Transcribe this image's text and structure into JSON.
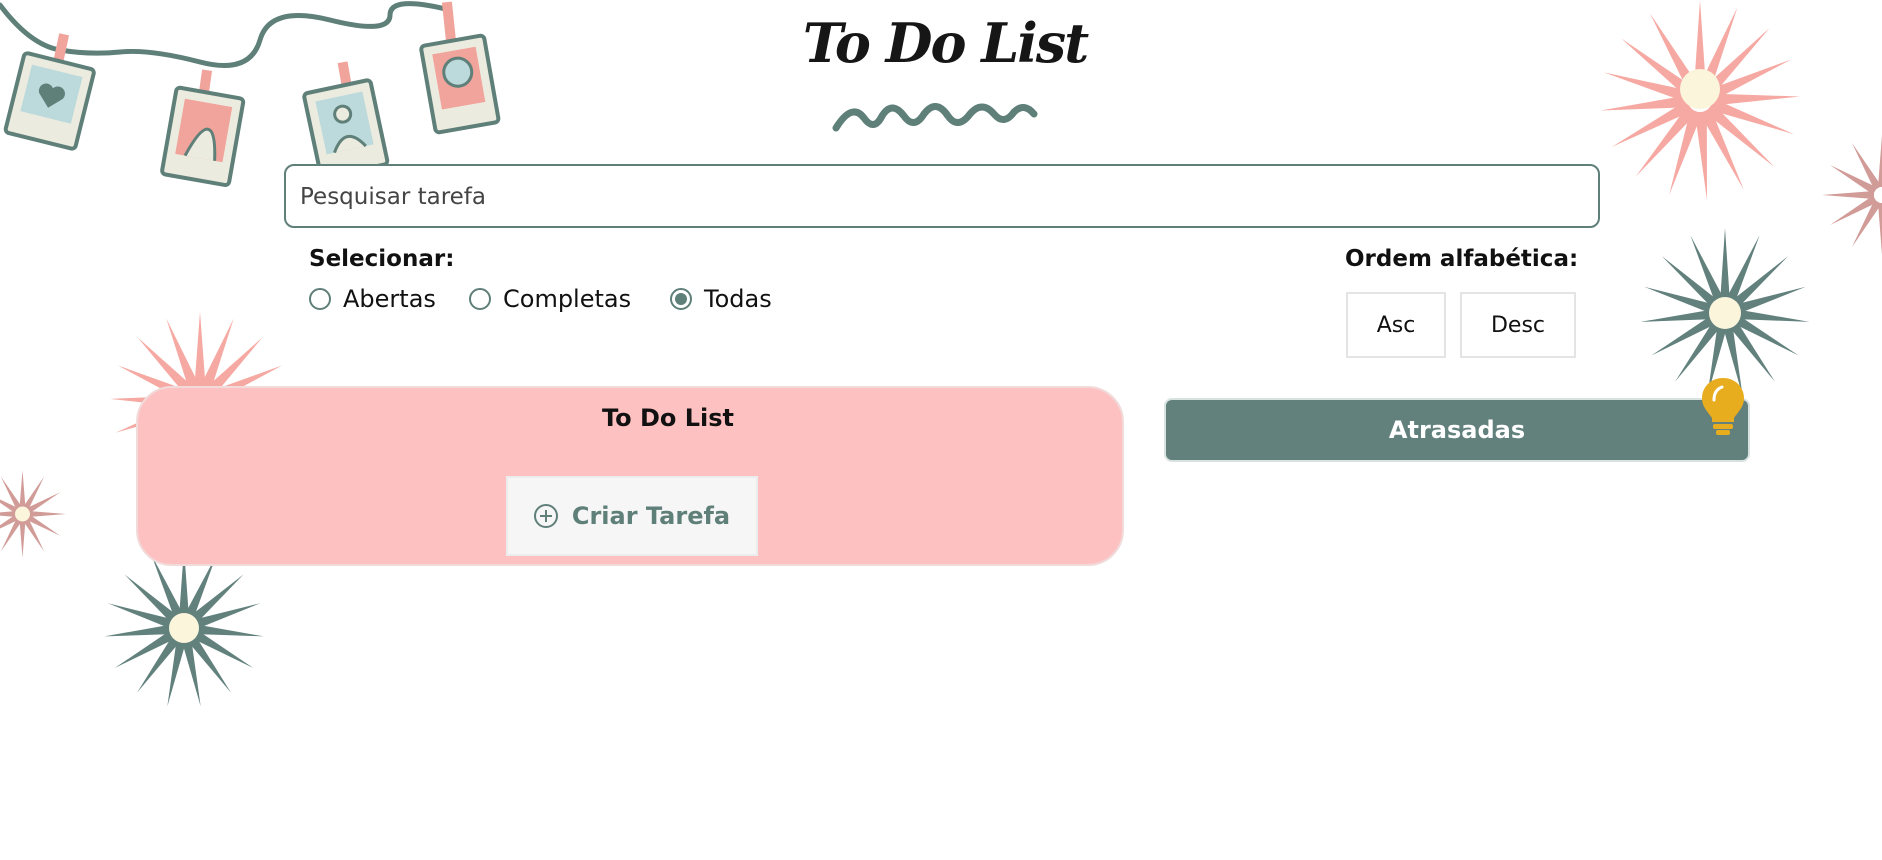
{
  "header": {
    "title": "To Do List"
  },
  "search": {
    "placeholder": "Pesquisar tarefa",
    "value": ""
  },
  "filter": {
    "label": "Selecionar:",
    "options": [
      {
        "label": "Abertas",
        "checked": false
      },
      {
        "label": "Completas",
        "checked": false
      },
      {
        "label": "Todas",
        "checked": true
      }
    ]
  },
  "sort": {
    "label": "Ordem alfabética:",
    "asc_label": "Asc",
    "desc_label": "Desc"
  },
  "todo_panel": {
    "title": "To Do List",
    "create_label": "Criar Tarefa",
    "create_icon": "plus-circle-icon"
  },
  "overdue": {
    "label": "Atrasadas",
    "icon": "lightbulb-icon"
  },
  "colors": {
    "accent": "#62817d",
    "panel_pink": "#fec1c2",
    "flower_pink": "#f6a9a2",
    "flower_rose": "#d19b97",
    "flower_center": "#fbf5dc",
    "bulb_yellow": "#e8ad1e"
  }
}
